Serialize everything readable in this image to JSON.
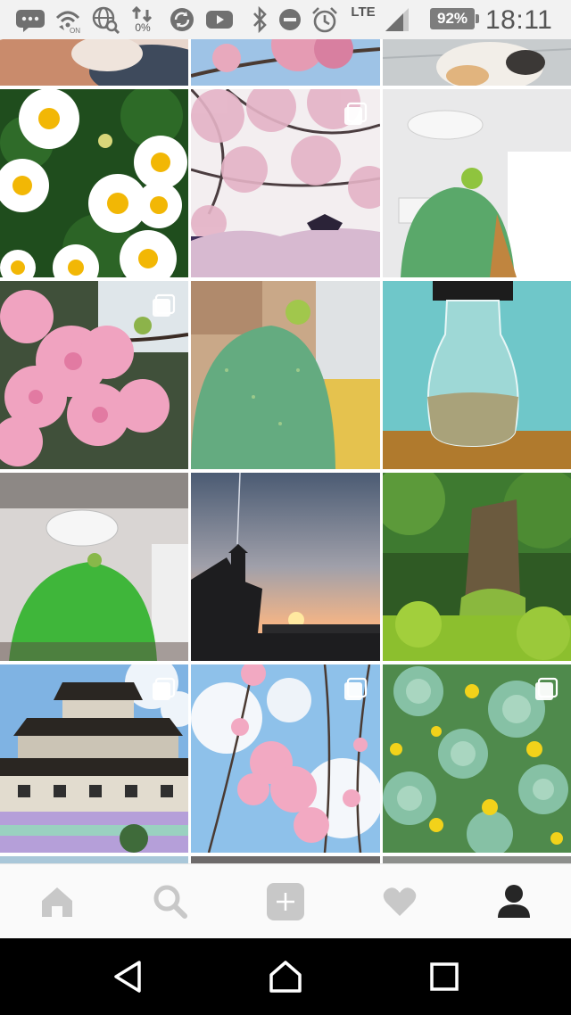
{
  "status_bar": {
    "data_saver_label": "0%",
    "network_type": "LTE",
    "battery_percent": "92%",
    "time": "18:11",
    "battery_level": 0.92
  },
  "grid": {
    "rows": [
      [
        {
          "subject": "blurred close-up (partially scrolled out)",
          "multi": false
        },
        {
          "subject": "cherry blossom branches (partially scrolled out)",
          "multi": false
        },
        {
          "subject": "cat on tiled floor (partially scrolled out)",
          "multi": false
        }
      ],
      [
        {
          "subject": "white daisies",
          "multi": false
        },
        {
          "subject": "cherry blossoms over castle",
          "multi": true
        },
        {
          "subject": "cactus pad in room",
          "multi": false
        }
      ],
      [
        {
          "subject": "pink cherry blossom close-up",
          "multi": true
        },
        {
          "subject": "cactus pad close-up",
          "multi": false
        },
        {
          "subject": "glass bottle on teal background",
          "multi": false
        }
      ],
      [
        {
          "subject": "green cactus under ceiling lamp",
          "multi": false
        },
        {
          "subject": "sunset silhouette with tower",
          "multi": false
        },
        {
          "subject": "mossy tree stump in forest",
          "multi": false
        }
      ],
      [
        {
          "subject": "black castle against blue sky",
          "multi": true
        },
        {
          "subject": "weeping cherry blossoms",
          "multi": true
        },
        {
          "subject": "succulents with yellow flowers",
          "multi": true
        }
      ]
    ]
  },
  "bottom_nav": {
    "items": [
      {
        "icon": "home-icon",
        "active": false
      },
      {
        "icon": "search-icon",
        "active": false
      },
      {
        "icon": "add-post-icon",
        "active": false
      },
      {
        "icon": "heart-icon",
        "active": false
      },
      {
        "icon": "profile-icon",
        "active": true
      }
    ],
    "inactive_color": "#c8c8c8",
    "active_color": "#262626"
  },
  "system_nav": {
    "buttons": [
      "back-icon",
      "home-circle-icon",
      "recents-icon"
    ]
  }
}
